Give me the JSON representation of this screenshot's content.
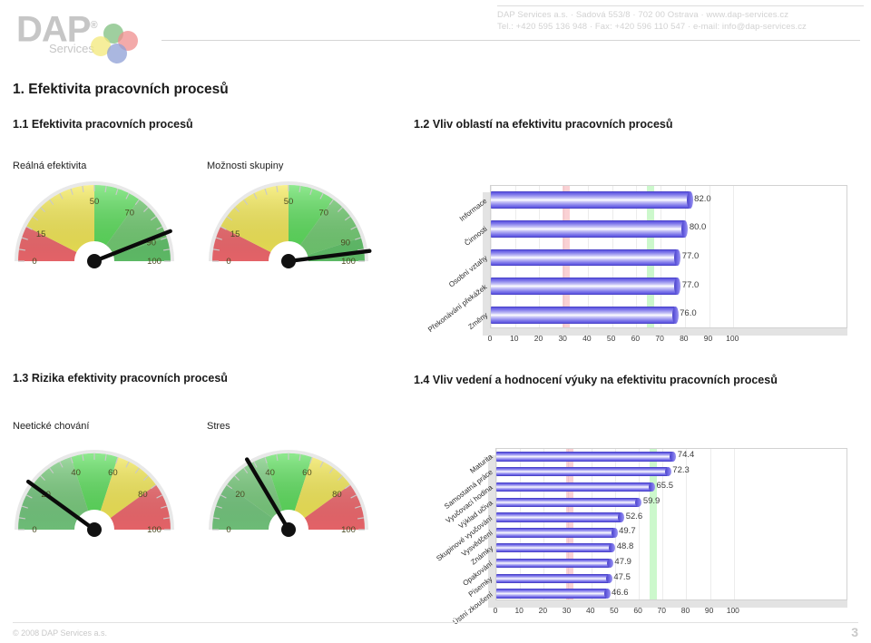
{
  "header": {
    "logo": {
      "brand": "DAP",
      "registered": "®",
      "sub": "Services"
    },
    "contact_line1": "DAP Services a.s.  ·  Sadová 553/8  ·  702 00 Ostrava  ·  www.dap-services.cz",
    "contact_line2": "Tel.:  +420 595 136 948   ·   Fax:  +420 596 110 547   ·   e-mail: info@dap-services.cz"
  },
  "page_title": "1. Efektivita pracovních procesů",
  "sections": {
    "s11": {
      "heading": "1.1 Efektivita pracovních procesů"
    },
    "s12": {
      "heading": "1.2 Vliv oblastí na efektivitu pracovních procesů"
    },
    "s13": {
      "heading": "1.3 Rizika efektivity pracovních procesů"
    },
    "s14": {
      "heading": "1.4 Vliv vedení a hodnocení výuky na efektivitu pracovních procesů"
    }
  },
  "gauges": [
    {
      "label": "Reálná efektivita",
      "value": 88,
      "ticks": [
        "0",
        "15",
        "50",
        "70",
        "90",
        "100"
      ],
      "tick_values": [
        0,
        15,
        50,
        70,
        90,
        100
      ],
      "scheme": "risk-normal"
    },
    {
      "label": "Možnosti skupiny",
      "value": 96,
      "ticks": [
        "0",
        "15",
        "50",
        "70",
        "90",
        "100"
      ],
      "tick_values": [
        0,
        15,
        50,
        70,
        90,
        100
      ],
      "scheme": "risk-normal"
    },
    {
      "label": "Neetické chování",
      "value": 20,
      "ticks": [
        "0",
        "20",
        "40",
        "60",
        "80",
        "100"
      ],
      "tick_values": [
        0,
        20,
        40,
        60,
        80,
        100
      ],
      "scheme": "risk-reversed"
    },
    {
      "label": "Stres",
      "value": 33,
      "ticks": [
        "0",
        "20",
        "40",
        "60",
        "80",
        "100"
      ],
      "tick_values": [
        0,
        20,
        40,
        60,
        80,
        100
      ],
      "scheme": "risk-reversed"
    }
  ],
  "chart_data": [
    {
      "id": "areas-influence",
      "type": "bar",
      "orientation": "horizontal",
      "title": "1.2 Vliv oblastí na efektivitu pracovních procesů",
      "xlabel": "",
      "ylabel": "",
      "categories": [
        "Informace",
        "Činnosti",
        "Osobní vztahy",
        "Překonávání překážek",
        "Změny"
      ],
      "values": [
        82.0,
        80.0,
        77.0,
        77.0,
        76.0
      ],
      "data_labels": [
        "82.0",
        "80.0",
        "77.0",
        "77.0",
        "76.0"
      ],
      "xlim": [
        0,
        110
      ],
      "xticks": [
        0,
        10,
        20,
        30,
        40,
        50,
        60,
        70,
        80,
        90,
        100
      ],
      "xtick_labels": [
        "0",
        "10",
        "20",
        "30",
        "40",
        "50",
        "60",
        "70",
        "80",
        "90",
        "100"
      ],
      "grid": true,
      "legend": "none",
      "reference_bands": [
        {
          "name": "low-threshold",
          "at": 31,
          "color": "#f59aa0"
        },
        {
          "name": "high-threshold",
          "at": 66,
          "color": "#8ef08e"
        }
      ],
      "bar_color": "#6b63e3"
    },
    {
      "id": "teaching-influence",
      "type": "bar",
      "orientation": "horizontal",
      "title": "1.4 Vliv vedení a hodnocení výuky na efektivitu pracovních procesů",
      "xlabel": "",
      "ylabel": "",
      "categories": [
        "Maturita",
        "Samostatná práce",
        "Vyučovací hodina",
        "Výklad učiva",
        "Skupinové vyučování",
        "Vysvědčení",
        "Známky",
        "Opakování",
        "Písemky",
        "Ústní zkoušení"
      ],
      "values": [
        74.4,
        72.3,
        65.5,
        59.9,
        52.6,
        49.7,
        48.8,
        47.9,
        47.5,
        46.6
      ],
      "data_labels": [
        "74.4",
        "72.3",
        "65.5",
        "59.9",
        "52.6",
        "49.7",
        "48.8",
        "47.9",
        "47.5",
        "46.6"
      ],
      "xlim": [
        0,
        110
      ],
      "xticks": [
        0,
        10,
        20,
        30,
        40,
        50,
        60,
        70,
        80,
        90,
        100
      ],
      "xtick_labels": [
        "0",
        "10",
        "20",
        "30",
        "40",
        "50",
        "60",
        "70",
        "80",
        "90",
        "100"
      ],
      "grid": true,
      "legend": "none",
      "reference_bands": [
        {
          "name": "low-threshold",
          "at": 31,
          "color": "#f59aa0"
        },
        {
          "name": "high-threshold",
          "at": 66,
          "color": "#8ef08e"
        }
      ],
      "bar_color": "#6b63e3"
    }
  ],
  "footer": {
    "copyright": "© 2008 DAP Services a.s.",
    "page_number": "3"
  }
}
